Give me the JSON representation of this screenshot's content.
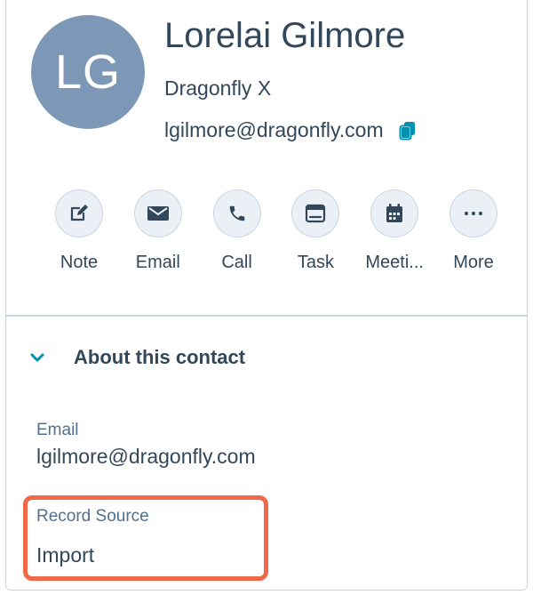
{
  "contact": {
    "initials": "LG",
    "name": "Lorelai Gilmore",
    "company": "Dragonfly X",
    "email": "lgilmore@dragonfly.com",
    "avatar_color": "#7c98b6"
  },
  "actions": [
    {
      "label": "Note",
      "icon": "note-edit-icon"
    },
    {
      "label": "Email",
      "icon": "envelope-icon"
    },
    {
      "label": "Call",
      "icon": "phone-icon"
    },
    {
      "label": "Task",
      "icon": "task-icon"
    },
    {
      "label": "Meeti...",
      "icon": "calendar-icon"
    },
    {
      "label": "More",
      "icon": "more-dots-icon"
    }
  ],
  "about_section": {
    "title": "About this contact",
    "fields": [
      {
        "label": "Email",
        "value": "lgilmore@dragonfly.com"
      },
      {
        "label": "Record Source",
        "value": "Import"
      }
    ]
  },
  "colors": {
    "accent_teal": "#0091ae",
    "highlight": "#f06a4a",
    "text": "#33475b"
  }
}
